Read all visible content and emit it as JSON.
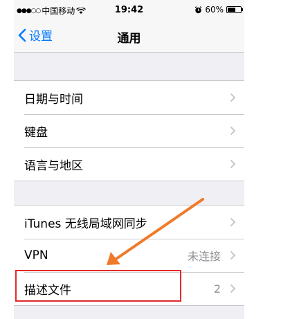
{
  "status_bar": {
    "carrier": "中国移动",
    "signal_icon": "signal-dots-icon",
    "wifi_icon": "wifi-icon",
    "time": "19:42",
    "alarm_icon": "alarm-icon",
    "battery_percent": "60%",
    "battery_level": 0.6
  },
  "nav": {
    "back_label": "设置",
    "title": "通用"
  },
  "group1": [
    {
      "label": "日期与时间"
    },
    {
      "label": "键盘"
    },
    {
      "label": "语言与地区"
    }
  ],
  "group2": [
    {
      "label": "iTunes 无线局域网同步",
      "detail": ""
    },
    {
      "label": "VPN",
      "detail": "未连接"
    },
    {
      "label": "描述文件",
      "detail": "2"
    }
  ],
  "colors": {
    "accent": "#007aff",
    "highlight": "#e0292b",
    "arrow": "#f07a2a"
  }
}
